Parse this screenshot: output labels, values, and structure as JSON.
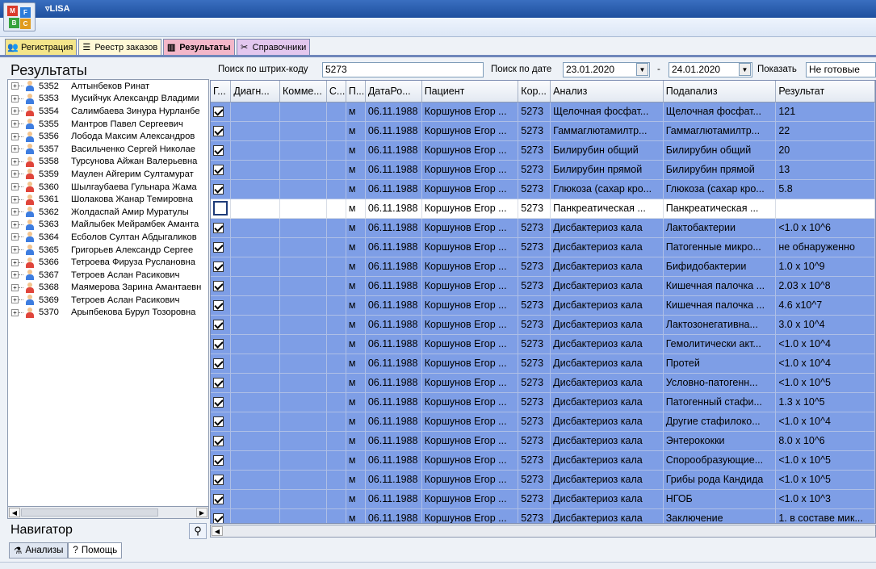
{
  "window": {
    "title": "LISA",
    "logo_letters": [
      "M",
      "F",
      "B",
      "C"
    ],
    "logo_colors": [
      "#d93a2b",
      "#2b7bd9",
      "#36a33c",
      "#e09b1e"
    ]
  },
  "tabs": [
    {
      "label": "Регистрация",
      "icon": "people-icon",
      "color": "#f4e58a"
    },
    {
      "label": "Реестр заказов",
      "icon": "list-icon",
      "color": "#fff8d6"
    },
    {
      "label": "Результаты",
      "icon": "chart-icon",
      "color": "#f3b7c9",
      "active": true
    },
    {
      "label": "Справочники",
      "icon": "tools-icon",
      "color": "#e3c7ee"
    }
  ],
  "left": {
    "title": "Результаты",
    "patients": [
      {
        "id": "5352",
        "name": "Алтынбеков Ринат",
        "gender": "m"
      },
      {
        "id": "5353",
        "name": "Мусийчук Александр Владими",
        "gender": "m"
      },
      {
        "id": "5354",
        "name": "Салимбаева Зинура Нурланбе",
        "gender": "f"
      },
      {
        "id": "5355",
        "name": "Мантров Павел Сергеевич",
        "gender": "m"
      },
      {
        "id": "5356",
        "name": "Лобода Максим Александров",
        "gender": "m"
      },
      {
        "id": "5357",
        "name": "Васильченко Сергей Николае",
        "gender": "m"
      },
      {
        "id": "5358",
        "name": "Турсунова Айжан Валерьевна",
        "gender": "f"
      },
      {
        "id": "5359",
        "name": "Маулен Айгерим Султамурат",
        "gender": "f"
      },
      {
        "id": "5360",
        "name": "Шылгаубаева Гульнара Жама",
        "gender": "f"
      },
      {
        "id": "5361",
        "name": "Шолакова Жанар Темировна",
        "gender": "f"
      },
      {
        "id": "5362",
        "name": "Жолдаспай Амир Муратулы",
        "gender": "m"
      },
      {
        "id": "5363",
        "name": "Майлыбек Мейрамбек Аманта",
        "gender": "m"
      },
      {
        "id": "5364",
        "name": "Есболов Султан Абдыгаликов",
        "gender": "m"
      },
      {
        "id": "5365",
        "name": "Григорьев Александр Сергее",
        "gender": "m"
      },
      {
        "id": "5366",
        "name": "Тетроева Фируза Руслановна",
        "gender": "f"
      },
      {
        "id": "5367",
        "name": "Тетроев Аслан Расикович",
        "gender": "m"
      },
      {
        "id": "5368",
        "name": "Маямерова Зарина Амантаевн",
        "gender": "f"
      },
      {
        "id": "5369",
        "name": "Тетроев Аслан Расикович",
        "gender": "m"
      },
      {
        "id": "5370",
        "name": "Арыпбекова Бурул Тозоровна",
        "gender": "f"
      }
    ],
    "navigator_title": "Навигатор",
    "nav_tabs": [
      {
        "label": "Анализы",
        "icon": "flask-icon"
      },
      {
        "label": "Помощь",
        "icon": "help-icon"
      }
    ]
  },
  "search": {
    "barcode_label": "Поиск по штрих-коду",
    "barcode_value": "5273",
    "date_label": "Поиск по дате",
    "date_from": "23.01.2020",
    "date_sep": "-",
    "date_to": "24.01.2020",
    "show_label": "Показать",
    "show_value": "Не готовые"
  },
  "grid": {
    "columns": [
      "Г...",
      "Диагн...",
      "Комме...",
      "С...",
      "П...",
      "ДатаРо...",
      "Пациент",
      "Кор...",
      "Анализ",
      "Подanaлиз",
      "Результат"
    ],
    "rows": [
      {
        "checked": true,
        "sex": "м",
        "dob": "06.11.1988",
        "patient": "Коршунов Егор ...",
        "code": "5273",
        "analysis": "Щелочная фосфат...",
        "sub": "Щелочная фосфат...",
        "result": "121"
      },
      {
        "checked": true,
        "sex": "м",
        "dob": "06.11.1988",
        "patient": "Коршунов Егор ...",
        "code": "5273",
        "analysis": "Гаммаглютамилтр...",
        "sub": "Гаммаглютамилтр...",
        "result": "22"
      },
      {
        "checked": true,
        "sex": "м",
        "dob": "06.11.1988",
        "patient": "Коршунов Егор ...",
        "code": "5273",
        "analysis": "Билирубин общий",
        "sub": "Билирубин общий",
        "result": "20"
      },
      {
        "checked": true,
        "sex": "м",
        "dob": "06.11.1988",
        "patient": "Коршунов Егор ...",
        "code": "5273",
        "analysis": "Билирубин прямой",
        "sub": "Билирубин прямой",
        "result": "13"
      },
      {
        "checked": true,
        "sex": "м",
        "dob": "06.11.1988",
        "patient": "Коршунов Егор ...",
        "code": "5273",
        "analysis": "Глюкоза (сахар кро...",
        "sub": "Глюкоза (сахар кро...",
        "result": "5.8"
      },
      {
        "checked": false,
        "sex": "м",
        "dob": "06.11.1988",
        "patient": "Коршунов Егор ...",
        "code": "5273",
        "analysis": "Панкреатическая ...",
        "sub": "Панкреатическая ...",
        "result": ""
      },
      {
        "checked": true,
        "sex": "м",
        "dob": "06.11.1988",
        "patient": "Коршунов Егор ...",
        "code": "5273",
        "analysis": "Дисбактериоз кала",
        "sub": "Лактобактерии",
        "result": "<1.0 x 10^6"
      },
      {
        "checked": true,
        "sex": "м",
        "dob": "06.11.1988",
        "patient": "Коршунов Егор ...",
        "code": "5273",
        "analysis": "Дисбактериоз кала",
        "sub": "Патогенные микро...",
        "result": "не обнаруженно"
      },
      {
        "checked": true,
        "sex": "м",
        "dob": "06.11.1988",
        "patient": "Коршунов Егор ...",
        "code": "5273",
        "analysis": "Дисбактериоз кала",
        "sub": "Бифидобактерии",
        "result": "1.0 x 10^9"
      },
      {
        "checked": true,
        "sex": "м",
        "dob": "06.11.1988",
        "patient": "Коршунов Егор ...",
        "code": "5273",
        "analysis": "Дисбактериоз кала",
        "sub": "Кишечная палочка ...",
        "result": "2.03 x 10^8"
      },
      {
        "checked": true,
        "sex": "м",
        "dob": "06.11.1988",
        "patient": "Коршунов Егор ...",
        "code": "5273",
        "analysis": "Дисбактериоз кала",
        "sub": "Кишечная палочка ...",
        "result": "4.6 x10^7"
      },
      {
        "checked": true,
        "sex": "м",
        "dob": "06.11.1988",
        "patient": "Коршунов Егор ...",
        "code": "5273",
        "analysis": "Дисбактериоз кала",
        "sub": "Лактозонегативна...",
        "result": "3.0 x 10^4"
      },
      {
        "checked": true,
        "sex": "м",
        "dob": "06.11.1988",
        "patient": "Коршунов Егор ...",
        "code": "5273",
        "analysis": "Дисбактериоз кала",
        "sub": "Гемолитически акт...",
        "result": "<1.0 x 10^4"
      },
      {
        "checked": true,
        "sex": "м",
        "dob": "06.11.1988",
        "patient": "Коршунов Егор ...",
        "code": "5273",
        "analysis": "Дисбактериоз кала",
        "sub": "Протей",
        "result": "<1.0 x 10^4"
      },
      {
        "checked": true,
        "sex": "м",
        "dob": "06.11.1988",
        "patient": "Коршунов Егор ...",
        "code": "5273",
        "analysis": "Дисбактериоз кала",
        "sub": "Условно-патогенн...",
        "result": "<1.0 x 10^5"
      },
      {
        "checked": true,
        "sex": "м",
        "dob": "06.11.1988",
        "patient": "Коршунов Егор ...",
        "code": "5273",
        "analysis": "Дисбактериоз кала",
        "sub": "Патогенный стафи...",
        "result": "1.3 x 10^5"
      },
      {
        "checked": true,
        "sex": "м",
        "dob": "06.11.1988",
        "patient": "Коршунов Егор ...",
        "code": "5273",
        "analysis": "Дисбактериоз кала",
        "sub": "Другие стафилоко...",
        "result": "<1.0 x 10^4"
      },
      {
        "checked": true,
        "sex": "м",
        "dob": "06.11.1988",
        "patient": "Коршунов Егор ...",
        "code": "5273",
        "analysis": "Дисбактериоз кала",
        "sub": "Энтерококки",
        "result": "8.0 x 10^6"
      },
      {
        "checked": true,
        "sex": "м",
        "dob": "06.11.1988",
        "patient": "Коршунов Егор ...",
        "code": "5273",
        "analysis": "Дисбактериоз кала",
        "sub": "Спорообразующие...",
        "result": "<1.0 x 10^5"
      },
      {
        "checked": true,
        "sex": "м",
        "dob": "06.11.1988",
        "patient": "Коршунов Егор ...",
        "code": "5273",
        "analysis": "Дисбактериоз кала",
        "sub": "Грибы рода Кандида",
        "result": "<1.0 x 10^5"
      },
      {
        "checked": true,
        "sex": "м",
        "dob": "06.11.1988",
        "patient": "Коршунов Егор ...",
        "code": "5273",
        "analysis": "Дисбактериоз кала",
        "sub": "НГОБ",
        "result": "<1.0 x 10^3"
      },
      {
        "checked": true,
        "sex": "м",
        "dob": "06.11.1988",
        "patient": "Коршунов Егор ...",
        "code": "5273",
        "analysis": "Дисбактериоз кала",
        "sub": "Заключение",
        "result": "1. в составе мик..."
      }
    ]
  }
}
